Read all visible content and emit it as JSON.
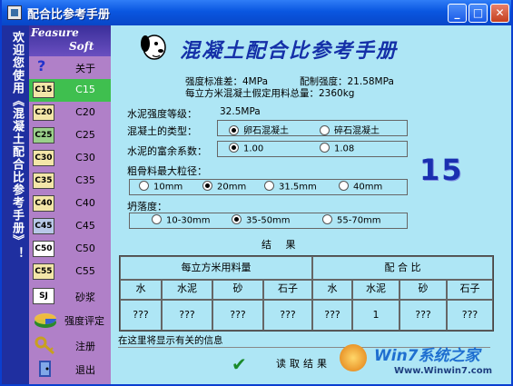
{
  "window": {
    "title": "配合比参考手册",
    "minimize_label": "_",
    "maximize_label": "□",
    "close_label": "✕"
  },
  "banner": {
    "text": "欢迎您使用《混凝土配合比参考手册》！"
  },
  "logo": {
    "line1": "Feasure",
    "line2": "Soft"
  },
  "menu": [
    {
      "icon": "?",
      "label": "关于"
    },
    {
      "icon": "C15",
      "label": "C15",
      "selected": true
    },
    {
      "icon": "C20",
      "label": "C20"
    },
    {
      "icon": "C25",
      "label": "C25"
    },
    {
      "icon": "C30",
      "label": "C30"
    },
    {
      "icon": "C35",
      "label": "C35"
    },
    {
      "icon": "C40",
      "label": "C40"
    },
    {
      "icon": "C45",
      "label": "C45"
    },
    {
      "icon": "C50",
      "label": "C50"
    },
    {
      "icon": "C55",
      "label": "C55"
    },
    {
      "icon": "SJ",
      "label": "砂浆"
    },
    {
      "icon": "",
      "label": "强度评定"
    },
    {
      "icon": "",
      "label": "注册"
    },
    {
      "icon": "",
      "label": "退出"
    }
  ],
  "header": {
    "title": "混凝土配合比参考手册",
    "std_dev": "强度标准差：4MPa",
    "prep_strength": "配制强度：21.58MPa",
    "total_mass": "每立方米混凝土假定用料总量：2360kg"
  },
  "form": {
    "cement_grade_label": "水泥强度等级：",
    "cement_grade_value": "32.5MPa",
    "type_label": "混凝土的类型：",
    "type_options": [
      "卵石混凝土",
      "碎石混凝土"
    ],
    "type_selected": 0,
    "surplus_label": "水泥的富余系数：",
    "surplus_options": [
      "1.00",
      "1.08"
    ],
    "surplus_selected": 0,
    "aggregate_label": "粗骨料最大粒径：",
    "aggregate_options": [
      "10mm",
      "20mm",
      "31.5mm",
      "40mm"
    ],
    "aggregate_selected": 1,
    "slump_label": "坍落度：",
    "slump_options": [
      "10-30mm",
      "35-50mm",
      "55-70mm"
    ],
    "slump_selected": 1
  },
  "grade_display": "15",
  "results": {
    "title": "结 果",
    "group1": "每立方米用料量",
    "group2": "配 合 比",
    "columns1": [
      "水",
      "水泥",
      "砂",
      "石子"
    ],
    "columns2": [
      "水",
      "水泥",
      "砂",
      "石子"
    ],
    "values1": [
      "???",
      "???",
      "???",
      "???"
    ],
    "values2": [
      "???",
      "1",
      "???",
      "???"
    ]
  },
  "status_text": "在这里将显示有关的信息",
  "read_button": "读取结果",
  "watermark": {
    "brand": "Win7系统之家",
    "url": "Www.Winwin7.com"
  }
}
